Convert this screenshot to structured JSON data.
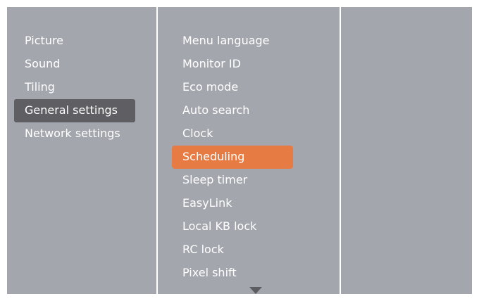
{
  "main_menu": {
    "items": [
      {
        "label": "Picture",
        "selected": false
      },
      {
        "label": "Sound",
        "selected": false
      },
      {
        "label": "Tiling",
        "selected": false
      },
      {
        "label": "General settings",
        "selected": true
      },
      {
        "label": "Network settings",
        "selected": false
      }
    ]
  },
  "sub_menu": {
    "items": [
      {
        "label": "Menu language",
        "selected": false
      },
      {
        "label": "Monitor ID",
        "selected": false
      },
      {
        "label": "Eco mode",
        "selected": false
      },
      {
        "label": "Auto search",
        "selected": false
      },
      {
        "label": "Clock",
        "selected": false
      },
      {
        "label": "Scheduling",
        "selected": true
      },
      {
        "label": "Sleep timer",
        "selected": false
      },
      {
        "label": "EasyLink",
        "selected": false
      },
      {
        "label": "Local KB lock",
        "selected": false
      },
      {
        "label": "RC lock",
        "selected": false
      },
      {
        "label": "Pixel shift",
        "selected": false
      }
    ],
    "more_indicator_icon": "triangle-down-icon"
  },
  "colors": {
    "panel_background": "#a4a6ae",
    "main_selection": "#5e5e63",
    "sub_selection": "#e67c43",
    "text": "#ffffff"
  }
}
